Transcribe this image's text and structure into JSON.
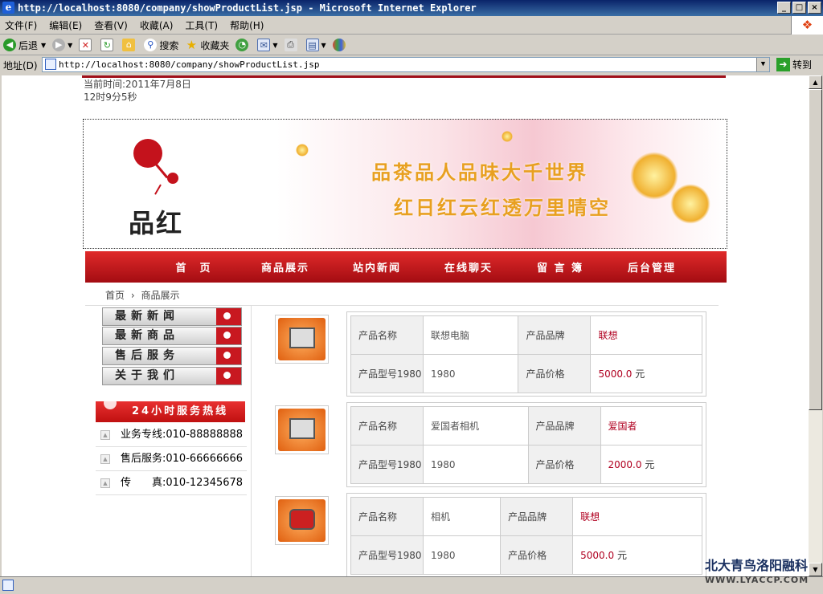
{
  "window": {
    "title": "http://localhost:8080/company/showProductList.jsp - Microsoft Internet Explorer",
    "controls": [
      "_",
      "□",
      "×"
    ]
  },
  "menubar": [
    "文件(F)",
    "编辑(E)",
    "查看(V)",
    "收藏(A)",
    "工具(T)",
    "帮助(H)"
  ],
  "toolbar": {
    "back": "后退",
    "search": "搜索",
    "favorites": "收藏夹"
  },
  "address": {
    "label": "地址(D)",
    "url": "http://localhost:8080/company/showProductList.jsp",
    "go": "转到"
  },
  "page": {
    "current_time_line1": "当前时间:2011年7月8日",
    "current_time_line2": "12时9分5秒",
    "logo_text": "品红",
    "slogan1": "品茶品人品味大千世界",
    "slogan2": "红日红云红透万里晴空",
    "nav": [
      "首　页",
      "商品展示",
      "站内新闻",
      "在线聊天",
      "留 言 簿",
      "后台管理"
    ],
    "breadcrumb_home": "首页",
    "breadcrumb_sep": "›",
    "breadcrumb_current": "商品展示",
    "side_menu": [
      "最新新闻",
      "最新商品",
      "售后服务",
      "关于我们"
    ],
    "hotline_title": "24小时服务热线",
    "phones": [
      "业务专线:010-88888888",
      "售后服务:010-66666666",
      "传　　真:010-12345678"
    ],
    "labels": {
      "name": "产品名称",
      "brand": "产品品牌",
      "model": "产品型号1980",
      "price": "产品价格",
      "unit": "元"
    },
    "products": [
      {
        "name": "联想电脑",
        "brand": "联想",
        "model": "1980",
        "price": "5000.0"
      },
      {
        "name": "爱国者相机",
        "brand": "爱国者",
        "model": "1980",
        "price": "2000.0"
      },
      {
        "name": "相机",
        "brand": "联想",
        "model": "1980",
        "price": "5000.0"
      }
    ]
  },
  "watermark": {
    "line1": "北大青鸟洛阳融科",
    "line2": "WWW.LYACCP.COM"
  }
}
